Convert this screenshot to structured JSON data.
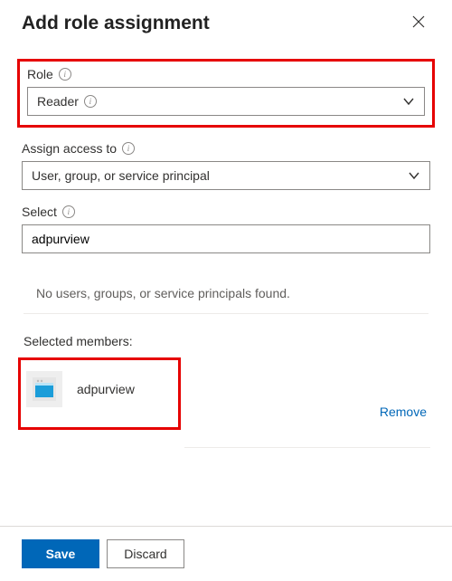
{
  "header": {
    "title": "Add role assignment"
  },
  "role": {
    "label": "Role",
    "value": "Reader"
  },
  "assign": {
    "label": "Assign access to",
    "value": "User, group, or service principal"
  },
  "select": {
    "label": "Select",
    "value": "adpurview"
  },
  "results": {
    "message": "No users, groups, or service principals found."
  },
  "members": {
    "label": "Selected members:",
    "items": [
      {
        "name": "adpurview"
      }
    ],
    "remove_label": "Remove"
  },
  "footer": {
    "save": "Save",
    "discard": "Discard"
  }
}
